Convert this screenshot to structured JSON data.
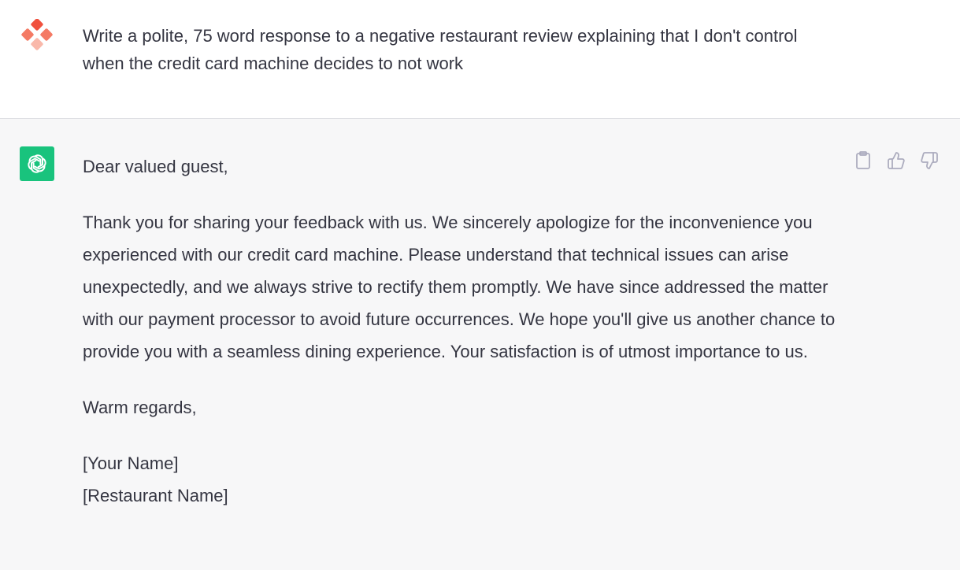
{
  "user_message": {
    "text": "Write a polite, 75 word response to a negative restaurant review explaining that I don't control when the credit card machine decides to not work",
    "avatar_icon": "user-diamond-avatar"
  },
  "assistant_message": {
    "avatar_icon": "openai-logo",
    "greeting": "Dear valued guest,",
    "body": "Thank you for sharing your feedback with us. We sincerely apologize for the inconvenience you experienced with our credit card machine. Please understand that technical issues can arise unexpectedly, and we always strive to rectify them promptly. We have since addressed the matter with our payment processor to avoid future occurrences. We hope you'll give us another chance to provide you with a seamless dining experience. Your satisfaction is of utmost importance to us.",
    "closing": "Warm regards,",
    "signature_name": "[Your Name]",
    "signature_restaurant": "[Restaurant Name]"
  },
  "actions": [
    {
      "icon": "clipboard-icon"
    },
    {
      "icon": "thumbs-up-icon"
    },
    {
      "icon": "thumbs-down-icon"
    }
  ],
  "colors": {
    "user_bg": "#ffffff",
    "assistant_bg": "#f7f7f8",
    "bot_avatar": "#19c37d",
    "text": "#343541",
    "avatar_accent": "#f0513e"
  }
}
